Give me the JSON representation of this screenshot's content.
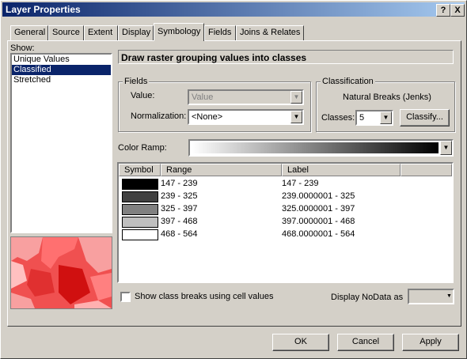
{
  "title": "Layer Properties",
  "title_buttons": {
    "help": "?",
    "close": "X"
  },
  "tabs": [
    "General",
    "Source",
    "Extent",
    "Display",
    "Symbology",
    "Fields",
    "Joins & Relates"
  ],
  "active_tab": "Symbology",
  "show": {
    "label": "Show:",
    "items": [
      "Unique Values",
      "Classified",
      "Stretched"
    ],
    "selected": "Classified"
  },
  "heading": "Draw raster grouping values into classes",
  "fields": {
    "title": "Fields",
    "value_label": "Value:",
    "value": "Value",
    "normalization_label": "Normalization:",
    "normalization": "<None>"
  },
  "classification": {
    "title": "Classification",
    "method": "Natural Breaks (Jenks)",
    "classes_label": "Classes:",
    "classes": "5",
    "classify_button": "Classify..."
  },
  "color_ramp": {
    "label": "Color Ramp:",
    "start_color": "#ffffff",
    "end_color": "#000000"
  },
  "table": {
    "headers": [
      "Symbol",
      "Range",
      "Label"
    ],
    "rows": [
      {
        "color": "#000000",
        "range": "147 - 239",
        "label": "147 - 239"
      },
      {
        "color": "#404040",
        "range": "239 - 325",
        "label": "239.0000001 - 325"
      },
      {
        "color": "#808080",
        "range": "325 - 397",
        "label": "325.0000001 - 397"
      },
      {
        "color": "#bfbfbf",
        "range": "397 - 468",
        "label": "397.0000001 - 468"
      },
      {
        "color": "#ffffff",
        "range": "468 - 564",
        "label": "468.0000001 - 564"
      }
    ]
  },
  "show_breaks_label": "Show class breaks using cell values",
  "nodata_label": "Display NoData as",
  "buttons": {
    "ok": "OK",
    "cancel": "Cancel",
    "apply": "Apply"
  }
}
